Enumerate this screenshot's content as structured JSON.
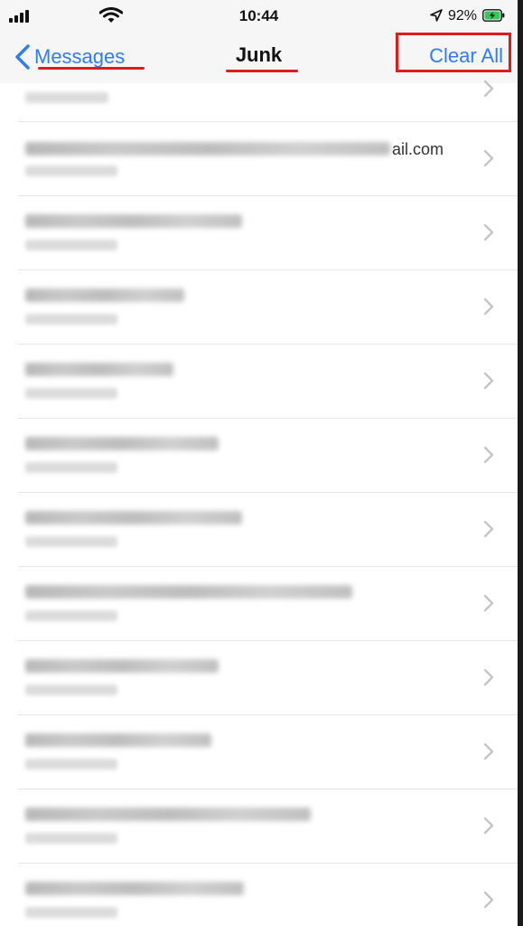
{
  "status_bar": {
    "time": "10:44",
    "battery_percent": "92%",
    "icons": [
      "signal-icon",
      "wifi-icon",
      "location-arrow-icon",
      "battery-charging-icon"
    ]
  },
  "nav": {
    "back_label": "Messages",
    "title": "Junk",
    "clear_label": "Clear All"
  },
  "list": {
    "rows": [
      {
        "visible_text": ""
      },
      {
        "visible_text": "ail.com"
      },
      {
        "visible_text": ""
      },
      {
        "visible_text": ""
      },
      {
        "visible_text": ""
      },
      {
        "visible_text": ""
      },
      {
        "visible_text": ""
      },
      {
        "visible_text": ""
      },
      {
        "visible_text": ""
      },
      {
        "visible_text": ""
      },
      {
        "visible_text": ""
      },
      {
        "visible_text": ""
      }
    ]
  },
  "colors": {
    "accent": "#2f7cf6",
    "annotation": "#e01b1b",
    "battery_charging": "#34c759"
  }
}
